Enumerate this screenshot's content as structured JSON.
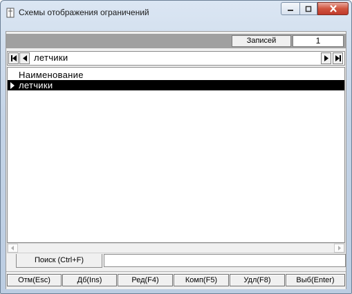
{
  "window": {
    "title": "Схемы отображения ограничений",
    "icon": "form-icon",
    "controls": [
      "minimize-icon",
      "maximize-icon",
      "close-icon"
    ]
  },
  "records": {
    "label": "Записей",
    "count": "1"
  },
  "navigator": {
    "current_text": "летчики",
    "buttons": [
      "first-record-icon",
      "prev-record-icon",
      "next-record-icon",
      "last-record-icon"
    ]
  },
  "grid": {
    "columns": [
      "Наименование"
    ],
    "rows": [
      {
        "name": "летчики",
        "selected": true
      }
    ]
  },
  "search": {
    "label": "Поиск (Ctrl+F)",
    "value": ""
  },
  "buttons": [
    {
      "label": "Отм(Esc)"
    },
    {
      "label": "Дб(Ins)"
    },
    {
      "label": "Ред(F4)"
    },
    {
      "label": "Комп(F5)"
    },
    {
      "label": "Удл(F8)"
    },
    {
      "label": "Выб(Enter)"
    }
  ],
  "colors": {
    "selection": "#000000",
    "frame": "#bccde2",
    "close_button": "#c0392b",
    "panel": "#f0f0f0"
  }
}
